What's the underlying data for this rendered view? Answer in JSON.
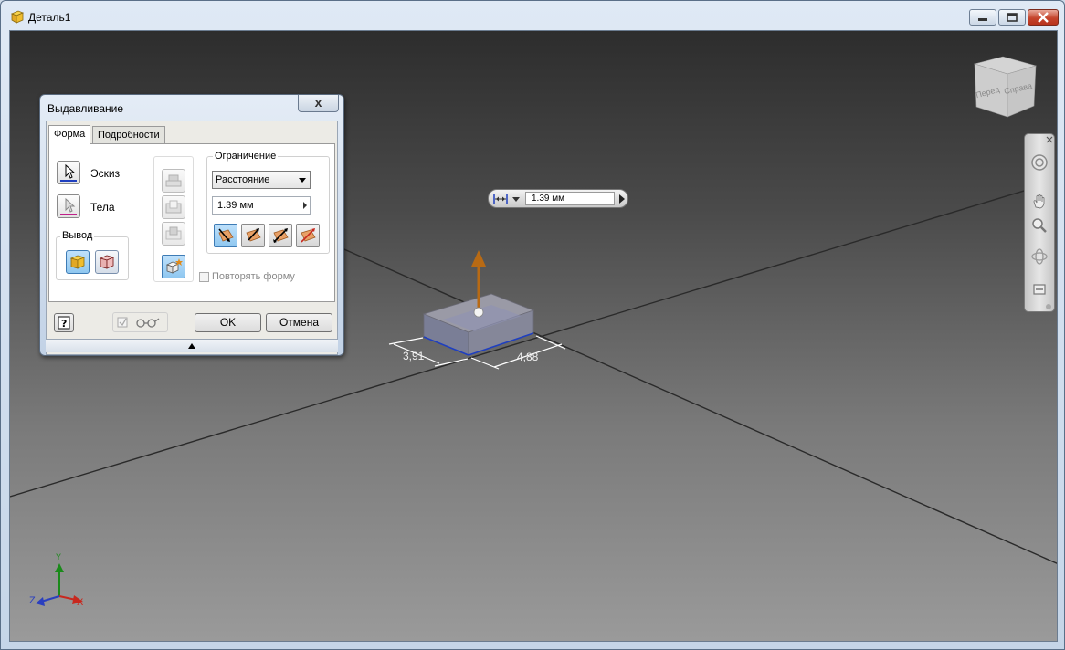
{
  "window": {
    "title": "Деталь1"
  },
  "dialog": {
    "title": "Выдавливание",
    "close_label": "x",
    "tabs": [
      {
        "label": "Форма",
        "active": true
      },
      {
        "label": "Подробности",
        "active": false
      }
    ],
    "profiles": {
      "sketch_label": "Эскиз",
      "bodies_label": "Тела"
    },
    "output": {
      "title": "Вывод"
    },
    "extents": {
      "title": "Ограничение",
      "type": "Расстояние",
      "distance": "1.39 мм"
    },
    "match_shape_label": "Повторять форму",
    "buttons": {
      "ok": "OK",
      "cancel": "Отмена",
      "help": "?"
    }
  },
  "minitoolbar": {
    "value": "1.39 мм"
  },
  "dimensions": {
    "left": "3,91",
    "right": "4,88"
  },
  "viewcube": {
    "front": "Перед",
    "right": "Справа"
  },
  "triad": {
    "x": "X",
    "y": "Y",
    "z": "Z"
  },
  "colors": {
    "accent_blue": "#1f3fbf",
    "arrow_orange": "#b86a14"
  }
}
